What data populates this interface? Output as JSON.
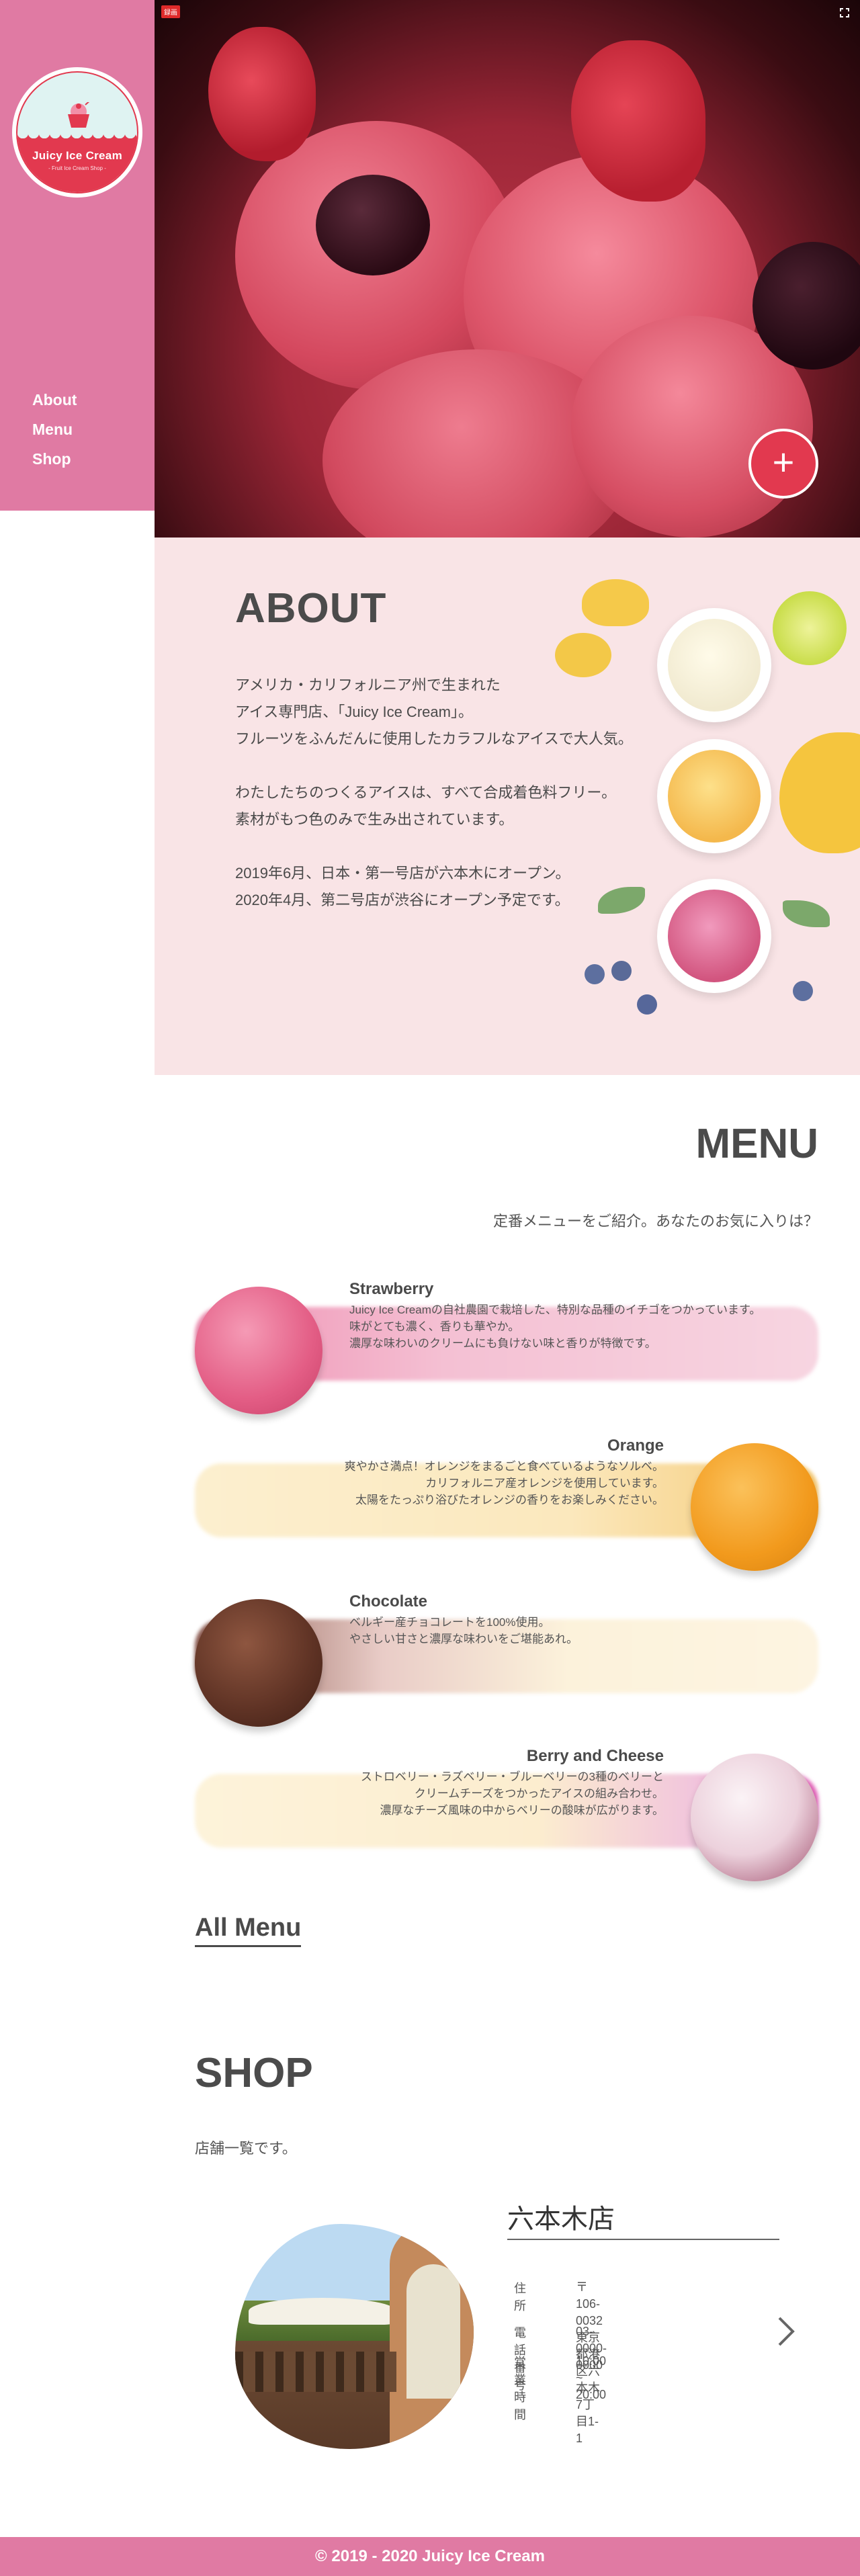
{
  "brand": {
    "name": "Juicy Ice Cream",
    "tagline": "- Fruit Ice Cream Shop -"
  },
  "nav": {
    "items": [
      "About",
      "Menu",
      "Shop"
    ]
  },
  "hero": {
    "badge": "録画"
  },
  "about": {
    "title": "ABOUT",
    "paragraphs": [
      [
        "アメリカ・カリフォルニア州で生まれた",
        "アイス専門店、「Juicy Ice Cream」。",
        "フルーツをふんだんに使用したカラフルなアイスで大人気。"
      ],
      [
        "わたしたちのつくるアイスは、すべて合成着色料フリー。",
        "素材がもつ色のみで生み出されています。"
      ],
      [
        "2019年6月、日本・第一号店が六本木にオープン。",
        "2020年4月、第二号店が渋谷にオープン予定です。"
      ]
    ]
  },
  "menu": {
    "title": "MENU",
    "subtitle": "定番メニューをご紹介。あなたのお気に入りは？",
    "items": [
      {
        "name": "Strawberry",
        "desc": [
          "Juicy Ice Creamの自社農園で栽培した、特別な品種のイチゴをつかっています。",
          "味がとても濃く、香りも華やか。",
          "濃厚な味わいのクリームにも負けない味と香りが特徴です。"
        ]
      },
      {
        "name": "Orange",
        "desc": [
          "爽やかさ満点！オレンジをまるごと食べているようなソルベ。",
          "カリフォルニア産オレンジを使用しています。",
          "太陽をたっぷり浴びたオレンジの香りをお楽しみください。"
        ]
      },
      {
        "name": "Chocolate",
        "desc": [
          "ベルギー産チョコレートを100%使用。",
          "やさしい甘さと濃厚な味わいをご堪能あれ。"
        ]
      },
      {
        "name": "Berry and Cheese",
        "desc": [
          "ストロベリー・ラズベリー・ブルーベリーの3種のベリーと",
          "クリームチーズをつかったアイスの組み合わせ。",
          "濃厚なチーズ風味の中からベリーの酸味が広がります。"
        ]
      }
    ],
    "all_menu_label": "All Menu"
  },
  "shop": {
    "title": "SHOP",
    "subtitle": "店舗一覧です。",
    "store": {
      "name": "六本木店",
      "address_label": "住所",
      "address_zip": "〒106-0032",
      "address": "東京都港区六本木7丁目1-1",
      "phone_label": "電話番号",
      "phone": "03-0000-0000",
      "hours_label": "営業時間",
      "hours": "10:00 ~ 20:00"
    }
  },
  "footer": {
    "text": "© 2019 - 2020 Juicy Ice Cream"
  },
  "colors": {
    "accent_pink": "#e07aa3",
    "brand_red": "#e2394f",
    "about_bg": "#f9e4e6"
  },
  "icons": [
    "ice-cream-cup-icon",
    "plus-icon",
    "fullscreen-icon",
    "chevron-right-icon"
  ]
}
